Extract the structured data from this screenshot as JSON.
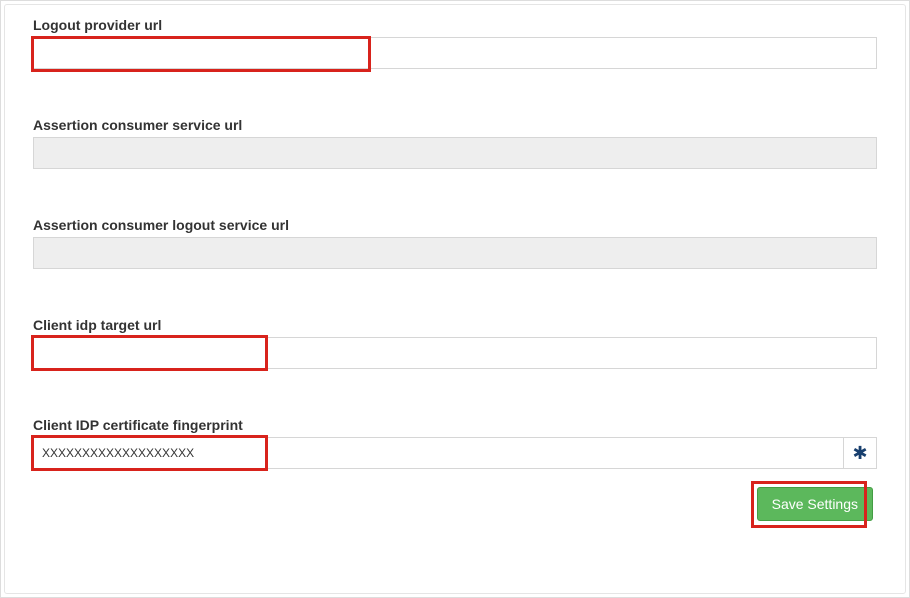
{
  "fields": {
    "logout_provider_url": {
      "label": "Logout provider url",
      "value": "",
      "readonly": false,
      "highlighted": true
    },
    "assertion_consumer_service_url": {
      "label": "Assertion consumer service url",
      "value": "",
      "readonly": true,
      "highlighted": false
    },
    "assertion_consumer_logout_service_url": {
      "label": "Assertion consumer logout service url",
      "value": "",
      "readonly": true,
      "highlighted": false
    },
    "client_idp_target_url": {
      "label": "Client idp target url",
      "value": "",
      "readonly": false,
      "highlighted": true
    },
    "client_idp_certificate_fingerprint": {
      "label": "Client IDP certificate fingerprint",
      "value": "XXXXXXXXXXXXXXXXXXX",
      "readonly": false,
      "highlighted": true
    }
  },
  "icons": {
    "asterisk": "✱"
  },
  "buttons": {
    "save": "Save Settings",
    "save_highlighted": true
  }
}
